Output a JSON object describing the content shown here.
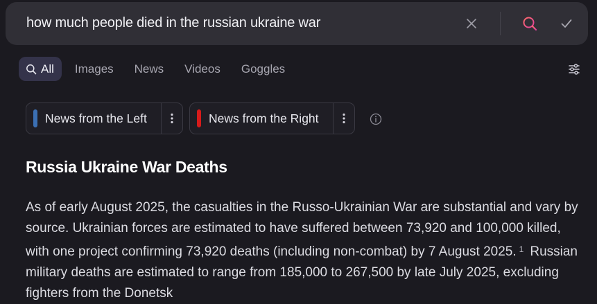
{
  "search": {
    "query": "how much people died in the russian ukraine war"
  },
  "tabs": [
    {
      "label": "All",
      "active": true
    },
    {
      "label": "Images",
      "active": false
    },
    {
      "label": "News",
      "active": false
    },
    {
      "label": "Videos",
      "active": false
    },
    {
      "label": "Goggles",
      "active": false
    }
  ],
  "filters": {
    "left": {
      "label": "News from the Left",
      "color": "#3b6fb3"
    },
    "right": {
      "label": "News from the Right",
      "color": "#d61b1b"
    }
  },
  "answer": {
    "title": "Russia Ukraine War Deaths",
    "text_before_cite": "As of early August 2025, the casualties in the Russo-Ukrainian War are substantial and vary by source. Ukrainian forces are estimated to have suffered between 73,920 and 100,000 killed, with one project confirming 73,920 deaths (including non-combat) by 7 August 2025.",
    "cite": "1",
    "text_after_cite": "Russian military deaths are estimated to range from 185,000 to 267,500 by late July 2025, excluding fighters from the Donetsk"
  },
  "colors": {
    "background": "#1b1a20",
    "searchbar": "#302f36",
    "active_tab": "#34334a",
    "search_icon": "#f0508a"
  },
  "icons": {
    "clear": "close-icon",
    "search": "search-icon",
    "submit": "check-icon",
    "tab_all": "search-icon",
    "settings": "sliders-icon",
    "more": "more-vertical-icon",
    "info": "info-icon"
  }
}
